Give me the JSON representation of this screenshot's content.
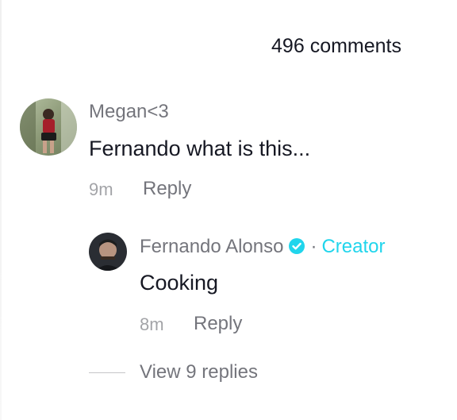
{
  "header": {
    "comment_count": "496 comments"
  },
  "comments": [
    {
      "username": "Megan<3",
      "text": "Fernando what is this...",
      "age": "9m",
      "reply_label": "Reply"
    }
  ],
  "reply": {
    "username": "Fernando Alonso",
    "badge_icon": "verified-icon",
    "separator": "·",
    "creator_label": "Creator",
    "text": "Cooking",
    "age": "8m",
    "reply_label": "Reply"
  },
  "view_replies_label": "View 9 replies",
  "colors": {
    "text": "#161823",
    "muted": "#8a8b91",
    "creator": "#20d5ec",
    "verified": "#20d5ec"
  }
}
